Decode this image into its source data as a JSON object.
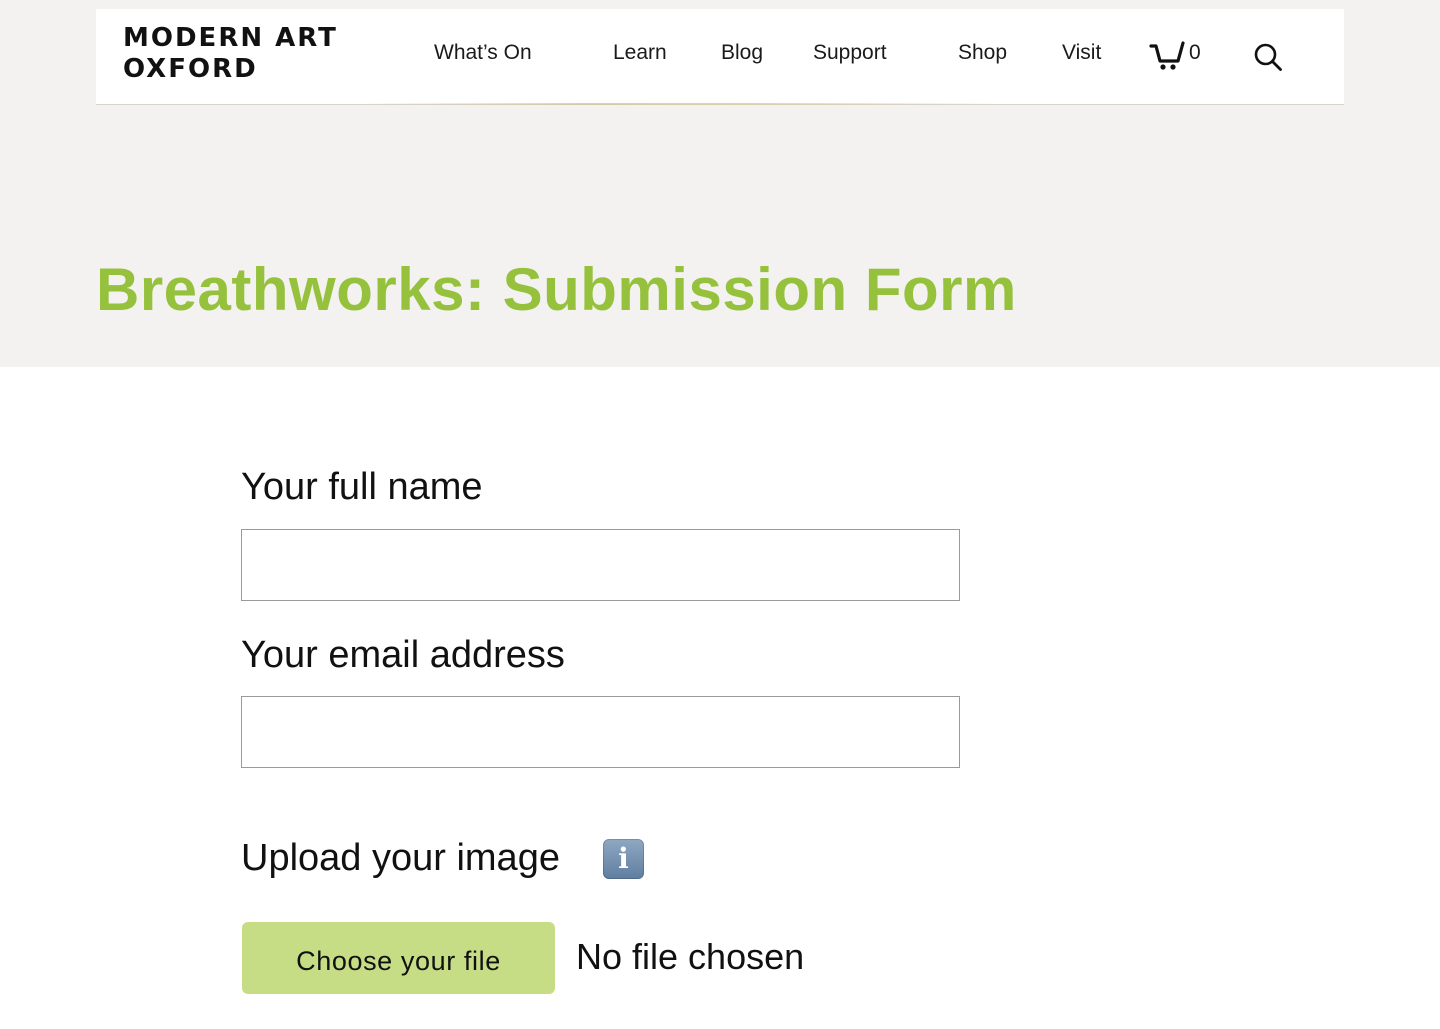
{
  "header": {
    "logo_line1": "MODERN ART",
    "logo_line2": "OXFORD",
    "nav": {
      "whats_on": "What’s On",
      "learn": "Learn",
      "blog": "Blog",
      "support": "Support",
      "shop": "Shop",
      "visit": "Visit"
    },
    "cart_count": "0",
    "cart_icon": "shopping-cart-icon",
    "search_icon": "search-icon"
  },
  "page": {
    "title": "Breathworks: Submission Form",
    "title_color": "#95c13c"
  },
  "form": {
    "name_label": "Your full name",
    "name_value": "",
    "email_label": "Your email address",
    "email_value": "",
    "upload_label": "Upload your image",
    "info_icon": "info-icon",
    "file_button_label": "Choose your file",
    "file_status": "No file chosen",
    "button_color": "#c6dc85"
  }
}
